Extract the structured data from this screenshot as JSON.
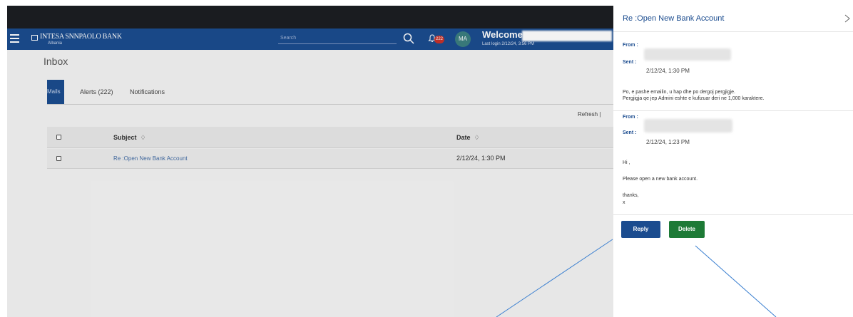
{
  "app": {
    "bank_name": "INTESA SNNPAOLO BANK",
    "region": "Albania",
    "search_placeholder": "Search",
    "alerts_badge": "222",
    "avatar_initials": "MA",
    "welcome": "Welcome,",
    "last_login": "Last login 2/12/24, 3:56 PM"
  },
  "inbox": {
    "title": "Inbox",
    "tabs": [
      "Mails",
      "Alerts (222)",
      "Notifications"
    ],
    "refresh": "Refresh |",
    "columns": {
      "subject": "Subject",
      "date": "Date"
    },
    "sort_icon": "♢",
    "rows": [
      {
        "subject": "Re :Open New Bank Account",
        "date": "2/12/24, 1:30 PM"
      }
    ]
  },
  "panel": {
    "title": "Re :Open New Bank Account",
    "messages": [
      {
        "from_label": "From :",
        "sent_label": "Sent :",
        "sent": "2/12/24, 1:30 PM",
        "body_lines": [
          "Po, e pashe emailin, u hap dhe po dergoj pergjigje.",
          "Pergjigja qe jep Admini eshte e kufizuar deri ne 1,000 karaktere."
        ]
      },
      {
        "from_label": "From :",
        "sent_label": "Sent :",
        "sent": "2/12/24, 1:23 PM",
        "body_lines": [
          "Hi ,",
          "Please open a new bank account.",
          "thanks,",
          "x"
        ]
      }
    ],
    "reply_label": "Reply",
    "delete_label": "Delete"
  },
  "colors": {
    "brand_blue": "#1b4c8f",
    "delete_green": "#1d7a36",
    "badge_red": "#c7322b",
    "arrow_blue": "#3a7fd0"
  }
}
